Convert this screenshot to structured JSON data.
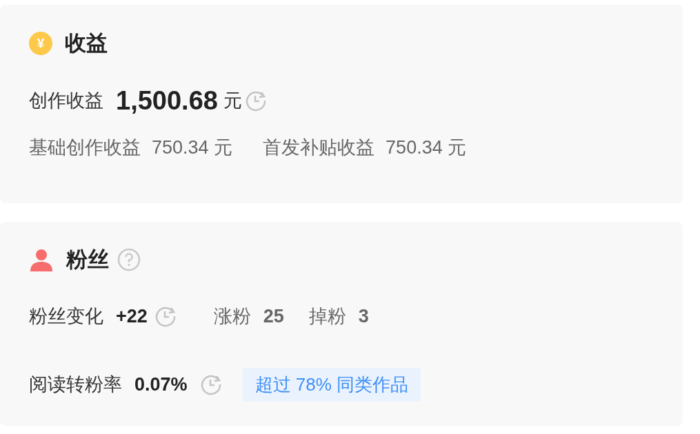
{
  "income": {
    "icon": "¥",
    "title": "收益",
    "total": {
      "label": "创作收益",
      "value": "1,500.68",
      "unit": "元"
    },
    "breakdown": [
      {
        "label": "基础创作收益",
        "value": "750.34 元"
      },
      {
        "label": "首发补贴收益",
        "value": "750.34 元"
      }
    ]
  },
  "fans": {
    "title": "粉丝",
    "change": {
      "label": "粉丝变化",
      "value": "+22"
    },
    "stats": [
      {
        "label": "涨粉",
        "value": "25"
      },
      {
        "label": "掉粉",
        "value": "3"
      }
    ],
    "rate": {
      "label": "阅读转粉率",
      "value": "0.07%",
      "badge": "超过 78% 同类作品"
    }
  }
}
